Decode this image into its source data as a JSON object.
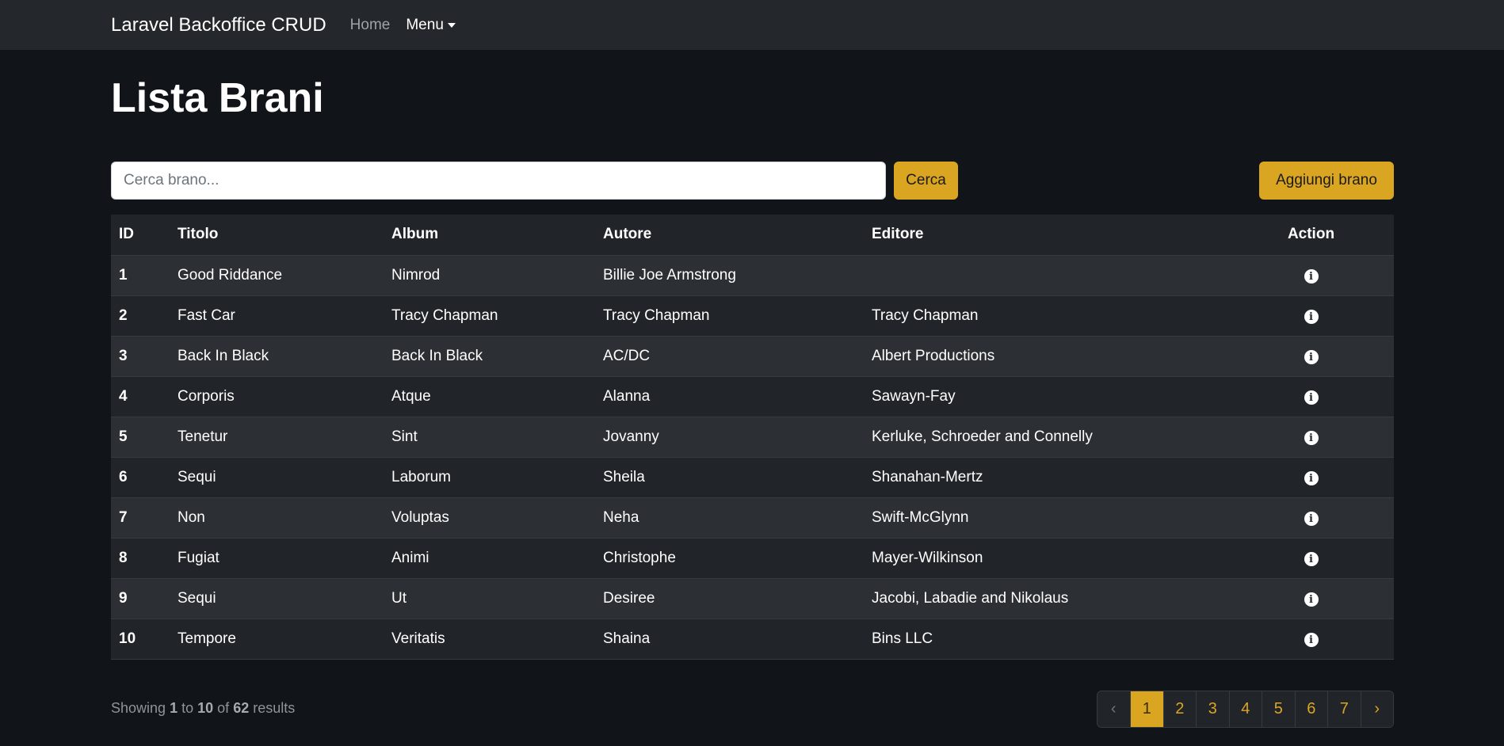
{
  "navbar": {
    "brand": "Laravel Backoffice CRUD",
    "home": "Home",
    "menu": "Menu"
  },
  "page_title": "Lista Brani",
  "search": {
    "placeholder": "Cerca brano...",
    "value": "",
    "button": "Cerca"
  },
  "add_button": "Aggiungi brano",
  "table": {
    "headers": [
      "ID",
      "Titolo",
      "Album",
      "Autore",
      "Editore",
      "Action"
    ],
    "rows": [
      {
        "id": "1",
        "titolo": "Good Riddance",
        "album": "Nimrod",
        "autore": "Billie Joe Armstrong",
        "editore": ""
      },
      {
        "id": "2",
        "titolo": "Fast Car",
        "album": "Tracy Chapman",
        "autore": "Tracy Chapman",
        "editore": "Tracy Chapman"
      },
      {
        "id": "3",
        "titolo": "Back In Black",
        "album": "Back In Black",
        "autore": "AC/DC",
        "editore": "Albert Productions"
      },
      {
        "id": "4",
        "titolo": "Corporis",
        "album": "Atque",
        "autore": "Alanna",
        "editore": "Sawayn-Fay"
      },
      {
        "id": "5",
        "titolo": "Tenetur",
        "album": "Sint",
        "autore": "Jovanny",
        "editore": "Kerluke, Schroeder and Connelly"
      },
      {
        "id": "6",
        "titolo": "Sequi",
        "album": "Laborum",
        "autore": "Sheila",
        "editore": "Shanahan-Mertz"
      },
      {
        "id": "7",
        "titolo": "Non",
        "album": "Voluptas",
        "autore": "Neha",
        "editore": "Swift-McGlynn"
      },
      {
        "id": "8",
        "titolo": "Fugiat",
        "album": "Animi",
        "autore": "Christophe",
        "editore": "Mayer-Wilkinson"
      },
      {
        "id": "9",
        "titolo": "Sequi",
        "album": "Ut",
        "autore": "Desiree",
        "editore": "Jacobi, Labadie and Nikolaus"
      },
      {
        "id": "10",
        "titolo": "Tempore",
        "album": "Veritatis",
        "autore": "Shaina",
        "editore": "Bins LLC"
      }
    ],
    "action_icon": "info-icon"
  },
  "results": {
    "prefix": "Showing",
    "from": "1",
    "to_word": "to",
    "to": "10",
    "of_word": "of",
    "total": "62",
    "suffix": "results"
  },
  "pagination": {
    "prev": "‹",
    "pages": [
      "1",
      "2",
      "3",
      "4",
      "5",
      "6",
      "7"
    ],
    "active": "1",
    "next": "›"
  },
  "colors": {
    "accent": "#daa520",
    "background": "#111418",
    "navbar": "#24272b"
  }
}
